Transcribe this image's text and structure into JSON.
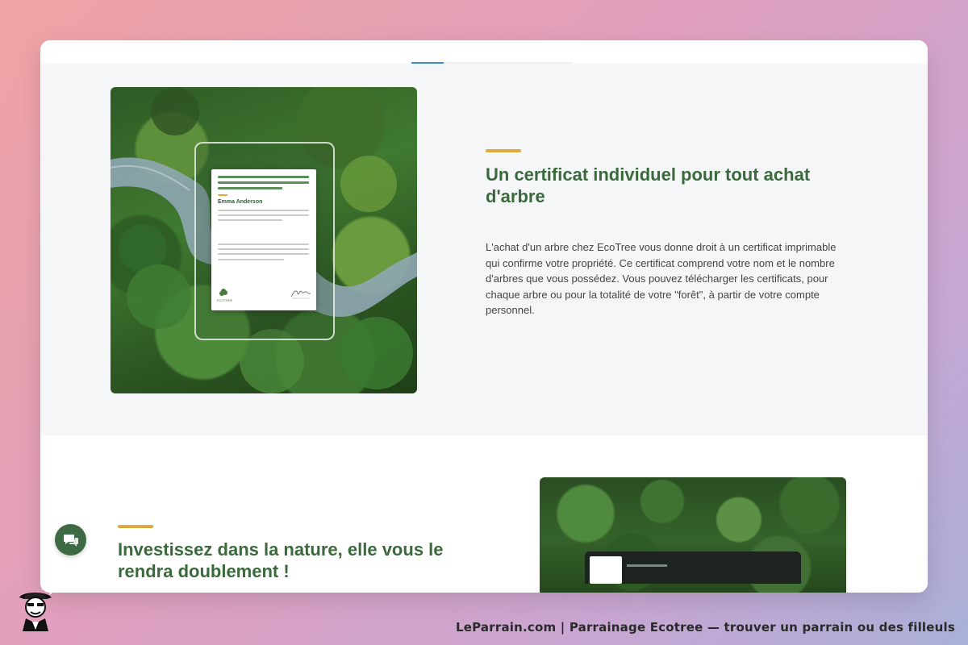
{
  "section1": {
    "title": "Un certificat individuel pour tout achat d'arbre",
    "body": "L'achat d'un arbre chez EcoTree vous donne droit à un certificat imprimable qui confirme votre propriété. Ce certificat comprend votre nom et le nombre d'arbres que vous possédez. Vous pouvez télécharger les certificats, pour chaque arbre ou pour la totalité de votre \"forêt\", à partir de votre compte personnel.",
    "certificate": {
      "name": "Emma Anderson",
      "logo_text": "ECOTREE"
    }
  },
  "section2": {
    "title": "Investissez dans la nature, elle vous le rendra doublement !"
  },
  "footer": {
    "text": "LeParrain.com | Parrainage Ecotree — trouver un parrain ou des filleuls"
  },
  "colors": {
    "accent": "#e0a93c",
    "heading": "#3a6a3c",
    "scroll_indicator": "#3b8fd9",
    "chat_button": "#3d6a43"
  },
  "icons": {
    "chat": "chat-bubbles-icon",
    "tree_logo": "tree-icon",
    "mascot": "detective-mascot-icon"
  }
}
